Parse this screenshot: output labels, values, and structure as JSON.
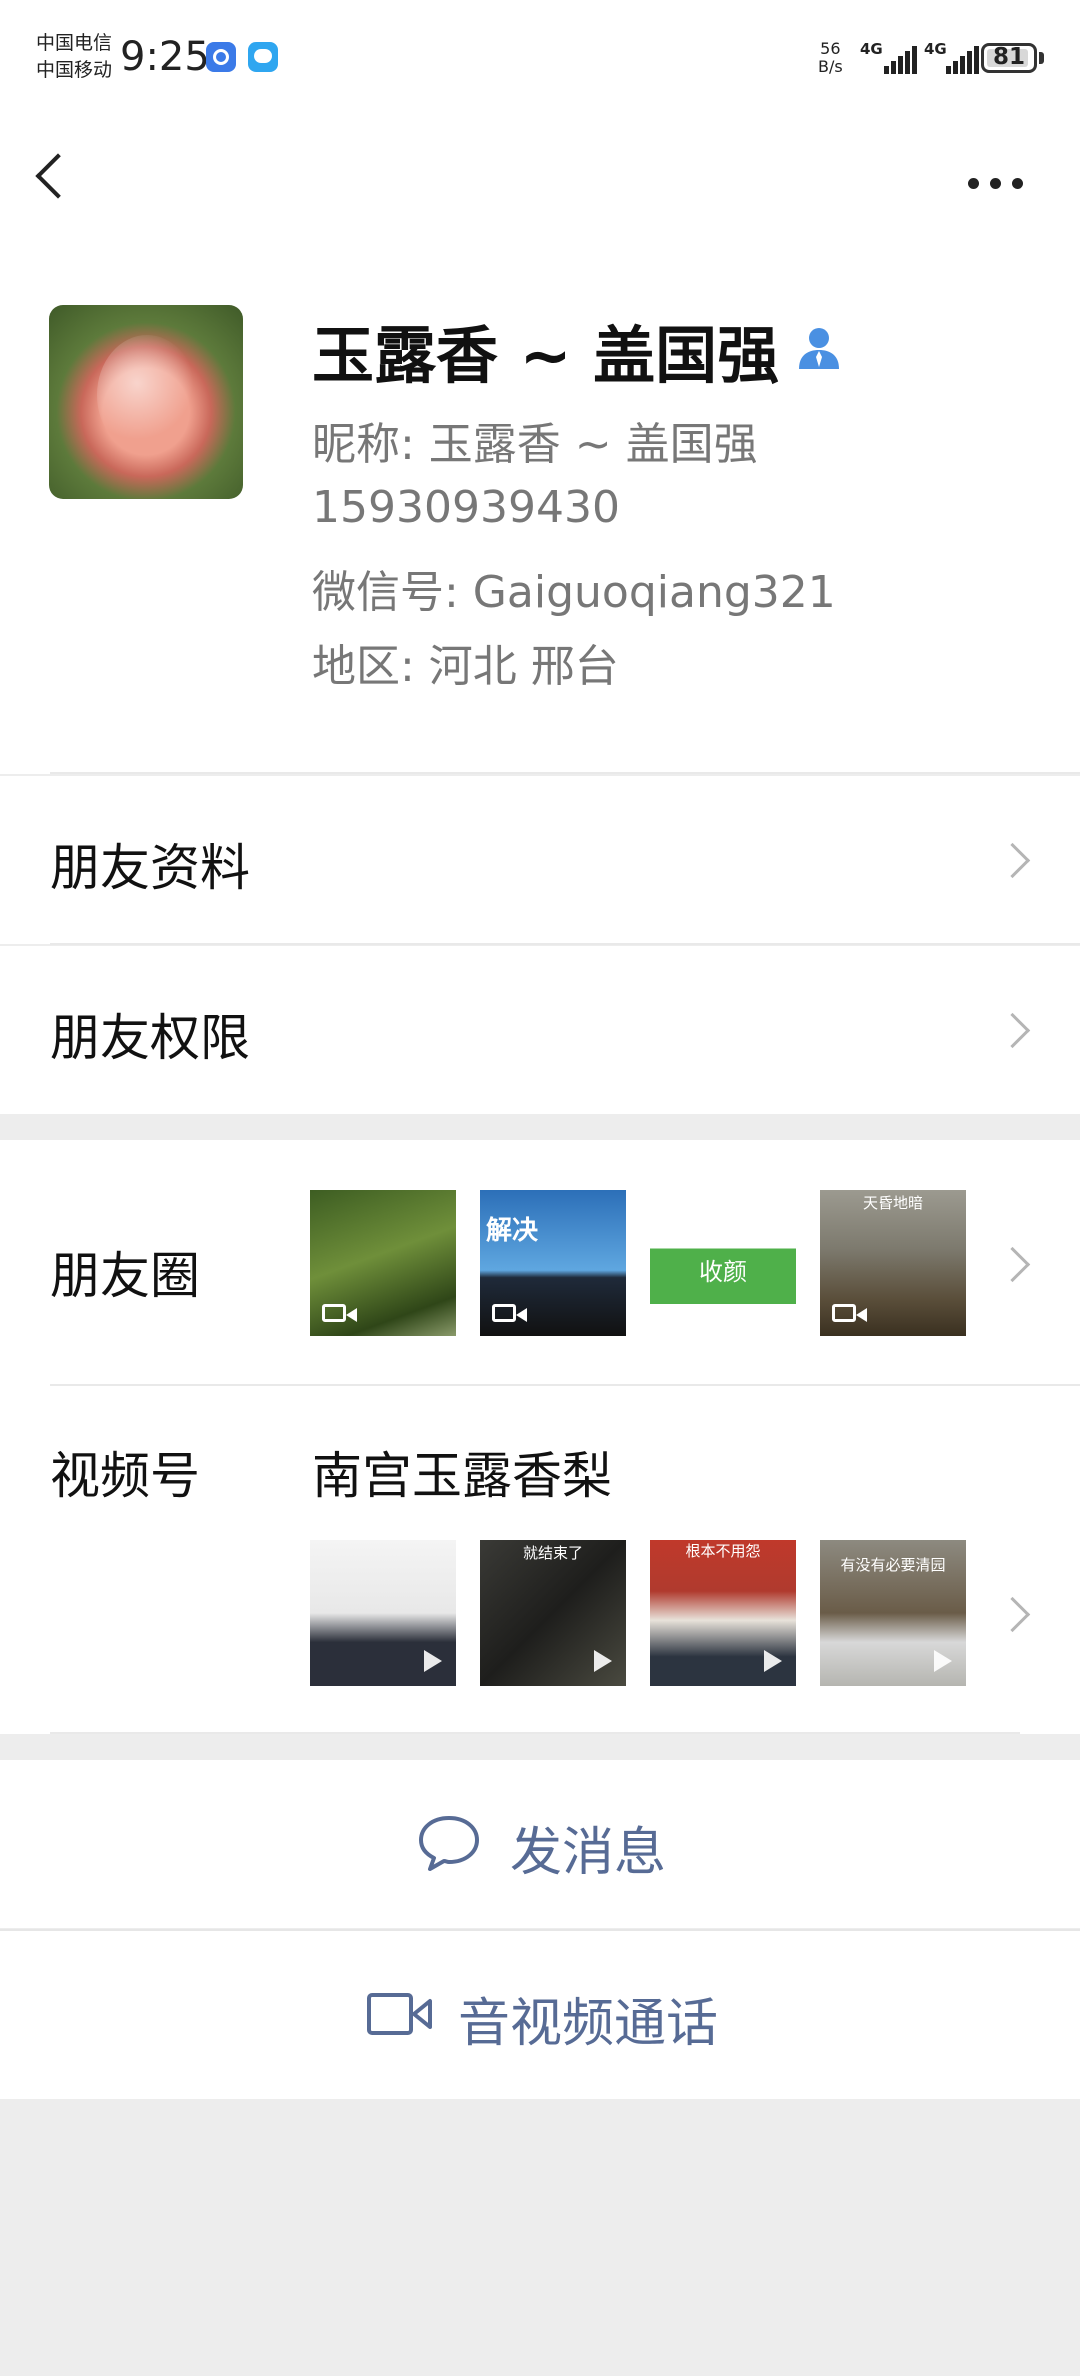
{
  "status_bar": {
    "carrier_1": "中国电信",
    "carrier_2": "中国移动",
    "time": "9:25",
    "net_speed_value": "56",
    "net_speed_unit": "B/s",
    "signal_1": "4G",
    "signal_2": "4G",
    "battery": "81"
  },
  "nav": {
    "back_icon": "chevron-left-icon",
    "more_icon": "more-dots-icon"
  },
  "profile": {
    "avatar_icon": "pear-avatar",
    "name": "玉露香 ~ 盖国强",
    "badge_icon": "user-icon",
    "nickname": "昵称:  玉露香 ~ 盖国强",
    "phone": "15930939430",
    "wechat_id": "微信号:  Gaiguoqiang321",
    "region": "地区:  河北  邢台"
  },
  "menu": {
    "friend_info": "朋友资料",
    "friend_permissions": "朋友权限"
  },
  "moments": {
    "label": "朋友圈",
    "thumbs": [
      {
        "type": "video",
        "text": ""
      },
      {
        "type": "video",
        "text": "解决"
      },
      {
        "type": "image",
        "text": "收颜"
      },
      {
        "type": "video",
        "text": "天昏地暗"
      }
    ]
  },
  "channels": {
    "label": "视频号",
    "channel_name": "南宫玉露香梨",
    "thumbs": [
      {
        "text": ""
      },
      {
        "text": "就结束了"
      },
      {
        "text": "根本不用怨"
      },
      {
        "text": "有没有必要清园"
      }
    ]
  },
  "actions": {
    "send_message": "发消息",
    "av_call": "音视频通话"
  },
  "colors": {
    "accent": "#576b95",
    "background": "#ededed"
  }
}
